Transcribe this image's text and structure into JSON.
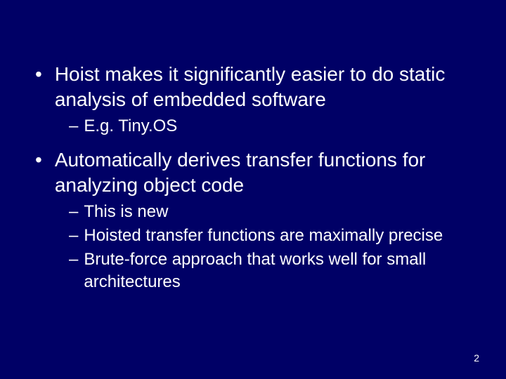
{
  "slide": {
    "bullets": [
      {
        "text": "Hoist makes it significantly easier to do static analysis of embedded software",
        "sub": [
          "E.g. Tiny.OS"
        ]
      },
      {
        "text": "Automatically derives transfer functions for analyzing object code",
        "sub": [
          "This is new",
          "Hoisted transfer functions are maximally precise",
          "Brute-force approach that works well for small architectures"
        ]
      }
    ],
    "pageNumber": "2",
    "markers": {
      "l1": "•",
      "l2": "–"
    }
  }
}
